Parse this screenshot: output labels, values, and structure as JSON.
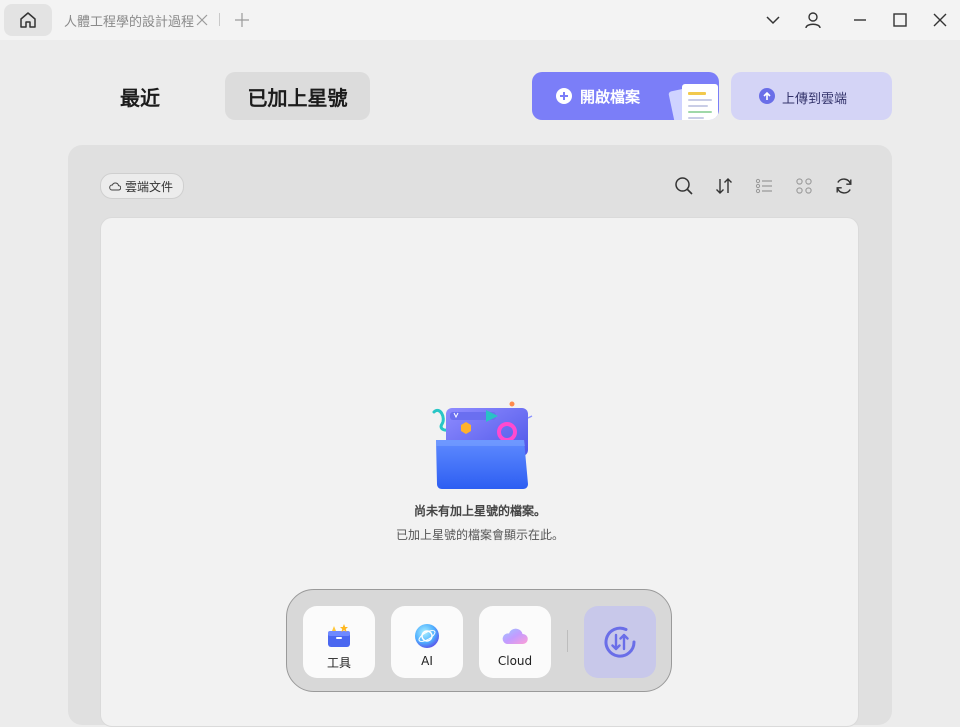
{
  "titlebar": {
    "doc_tab_title": "人體工程學的設計過程"
  },
  "tabs": {
    "recent": "最近",
    "starred": "已加上星號"
  },
  "actions": {
    "open_file": "開啟檔案",
    "upload_cloud": "上傳到雲端"
  },
  "toolbar": {
    "cloud_docs": "雲端文件",
    "icons": [
      "search-icon",
      "sort-icon",
      "list-view-icon",
      "grid-view-icon",
      "refresh-icon"
    ]
  },
  "empty_state": {
    "title": "尚未有加上星號的檔案。",
    "subtitle": "已加上星號的檔案會顯示在此。"
  },
  "dock": {
    "tools": "工具",
    "ai": "AI",
    "cloud": "Cloud"
  },
  "colors": {
    "accent": "#7b7ef8",
    "upload_bg": "#d4d4f6",
    "sync_bg": "#c8c8ea"
  }
}
